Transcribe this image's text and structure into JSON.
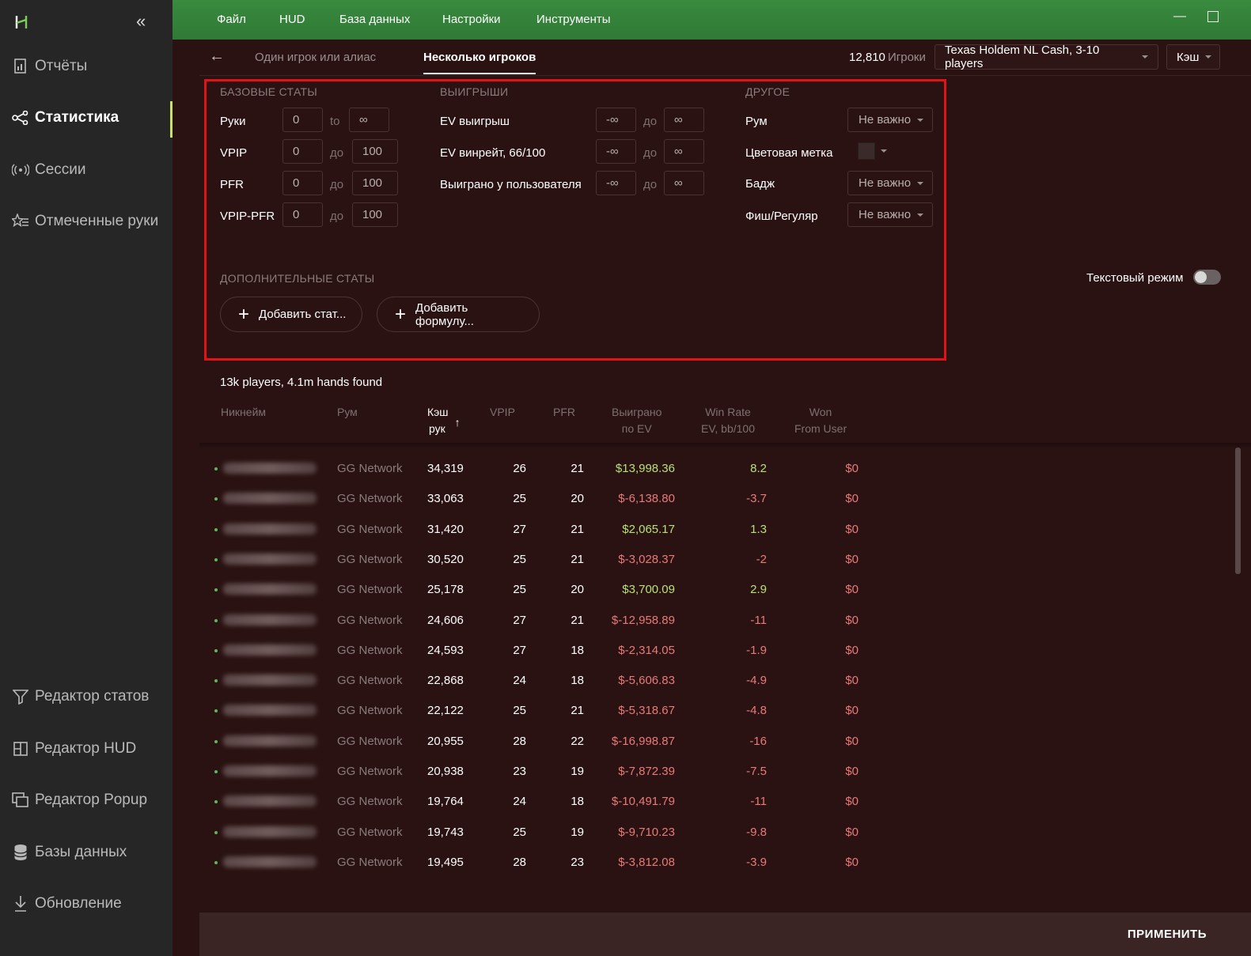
{
  "sidebar": {
    "items": [
      {
        "label": "Отчёты",
        "icon": "report-icon"
      },
      {
        "label": "Статистика",
        "icon": "share-nodes-icon"
      },
      {
        "label": "Сессии",
        "icon": "broadcast-icon"
      },
      {
        "label": "Отмеченные руки",
        "icon": "star-list-icon"
      },
      {
        "label": "Редактор статов",
        "icon": "filter-icon"
      },
      {
        "label": "Редактор HUD",
        "icon": "hud-layout-icon"
      },
      {
        "label": "Редактор Popup",
        "icon": "popup-icon"
      },
      {
        "label": "Базы данных",
        "icon": "database-icon"
      },
      {
        "label": "Обновление",
        "icon": "download-icon"
      }
    ]
  },
  "menu": [
    "Файл",
    "HUD",
    "База данных",
    "Настройки",
    "Инструменты"
  ],
  "tabs": {
    "single": "Один игрок или алиас",
    "multi": "Несколько игроков"
  },
  "header": {
    "count": "12,810",
    "count_label": "Игроки",
    "game": "Texas Holdem NL Cash, 3-10 players",
    "mode": "Кэш"
  },
  "filters": {
    "basic": {
      "title": "БАЗОВЫЕ СТАТЫ",
      "rows": [
        {
          "label": "Руки",
          "from": "0",
          "sep": "to",
          "to": "∞"
        },
        {
          "label": "VPIP",
          "from": "0",
          "sep": "до",
          "to": "100"
        },
        {
          "label": "PFR",
          "from": "0",
          "sep": "до",
          "to": "100"
        },
        {
          "label": "VPIP-PFR",
          "from": "0",
          "sep": "до",
          "to": "100"
        }
      ]
    },
    "winnings": {
      "title": "ВЫИГРЫШИ",
      "rows": [
        {
          "label": "EV выигрыш",
          "from": "-∞",
          "sep": "до",
          "to": "∞"
        },
        {
          "label": "EV винрейт, 66/100",
          "from": "-∞",
          "sep": "до",
          "to": "∞"
        },
        {
          "label": "Выиграно у пользователя",
          "from": "-∞",
          "sep": "до",
          "to": "∞"
        }
      ]
    },
    "other": {
      "title": "ДРУГОЕ",
      "room_label": "Рум",
      "room_value": "Не важно",
      "color_label": "Цветовая метка",
      "badge_label": "Бадж",
      "badge_value": "Не важно",
      "fish_label": "Фиш/Регуляр",
      "fish_value": "Не важно"
    },
    "extra": {
      "title": "ДОПОЛНИТЕЛЬНЫЕ СТАТЫ",
      "add_stat": "Добавить стат...",
      "add_formula": "Добавить формулу..."
    }
  },
  "text_mode": "Текстовый режим",
  "found": "13k players, 4.1m hands found",
  "table": {
    "headers": {
      "nick": "Никнейм",
      "room": "Рум",
      "hands_1": "Кэш",
      "hands_2": "рук",
      "sort_arrow": "↑",
      "vpip": "VPIP",
      "pfr": "PFR",
      "won_1": "Выиграно",
      "won_2": "по EV",
      "wr_1": "Win Rate",
      "wr_2": "EV, bb/100",
      "wfu_1": "Won",
      "wfu_2": "From User"
    },
    "rows": [
      {
        "room": "GG Network",
        "hands": "34,319",
        "vpip": "26",
        "pfr": "21",
        "won": "$13,998.36",
        "wr": "8.2",
        "wfu": "$0"
      },
      {
        "room": "GG Network",
        "hands": "33,063",
        "vpip": "25",
        "pfr": "20",
        "won": "$-6,138.80",
        "wr": "-3.7",
        "wfu": "$0"
      },
      {
        "room": "GG Network",
        "hands": "31,420",
        "vpip": "27",
        "pfr": "21",
        "won": "$2,065.17",
        "wr": "1.3",
        "wfu": "$0"
      },
      {
        "room": "GG Network",
        "hands": "30,520",
        "vpip": "25",
        "pfr": "21",
        "won": "$-3,028.37",
        "wr": "-2",
        "wfu": "$0"
      },
      {
        "room": "GG Network",
        "hands": "25,178",
        "vpip": "25",
        "pfr": "20",
        "won": "$3,700.09",
        "wr": "2.9",
        "wfu": "$0"
      },
      {
        "room": "GG Network",
        "hands": "24,606",
        "vpip": "27",
        "pfr": "21",
        "won": "$-12,958.89",
        "wr": "-11",
        "wfu": "$0"
      },
      {
        "room": "GG Network",
        "hands": "24,593",
        "vpip": "27",
        "pfr": "18",
        "won": "$-2,314.05",
        "wr": "-1.9",
        "wfu": "$0"
      },
      {
        "room": "GG Network",
        "hands": "22,868",
        "vpip": "24",
        "pfr": "18",
        "won": "$-5,606.83",
        "wr": "-4.9",
        "wfu": "$0"
      },
      {
        "room": "GG Network",
        "hands": "22,122",
        "vpip": "25",
        "pfr": "21",
        "won": "$-5,318.67",
        "wr": "-4.8",
        "wfu": "$0"
      },
      {
        "room": "GG Network",
        "hands": "20,955",
        "vpip": "28",
        "pfr": "22",
        "won": "$-16,998.87",
        "wr": "-16",
        "wfu": "$0"
      },
      {
        "room": "GG Network",
        "hands": "20,938",
        "vpip": "23",
        "pfr": "19",
        "won": "$-7,872.39",
        "wr": "-7.5",
        "wfu": "$0"
      },
      {
        "room": "GG Network",
        "hands": "19,764",
        "vpip": "24",
        "pfr": "18",
        "won": "$-10,491.79",
        "wr": "-11",
        "wfu": "$0"
      },
      {
        "room": "GG Network",
        "hands": "19,743",
        "vpip": "25",
        "pfr": "19",
        "won": "$-9,710.23",
        "wr": "-9.8",
        "wfu": "$0"
      },
      {
        "room": "GG Network",
        "hands": "19,495",
        "vpip": "28",
        "pfr": "23",
        "won": "$-3,812.08",
        "wr": "-3.9",
        "wfu": "$0"
      }
    ]
  },
  "apply": "ПРИМЕНИТЬ",
  "colors": {
    "accent": "#c8e070",
    "topbar": "#2f7a35",
    "positive": "#b7e07a",
    "negative": "#e87a7a",
    "highlight": "#e01414"
  }
}
